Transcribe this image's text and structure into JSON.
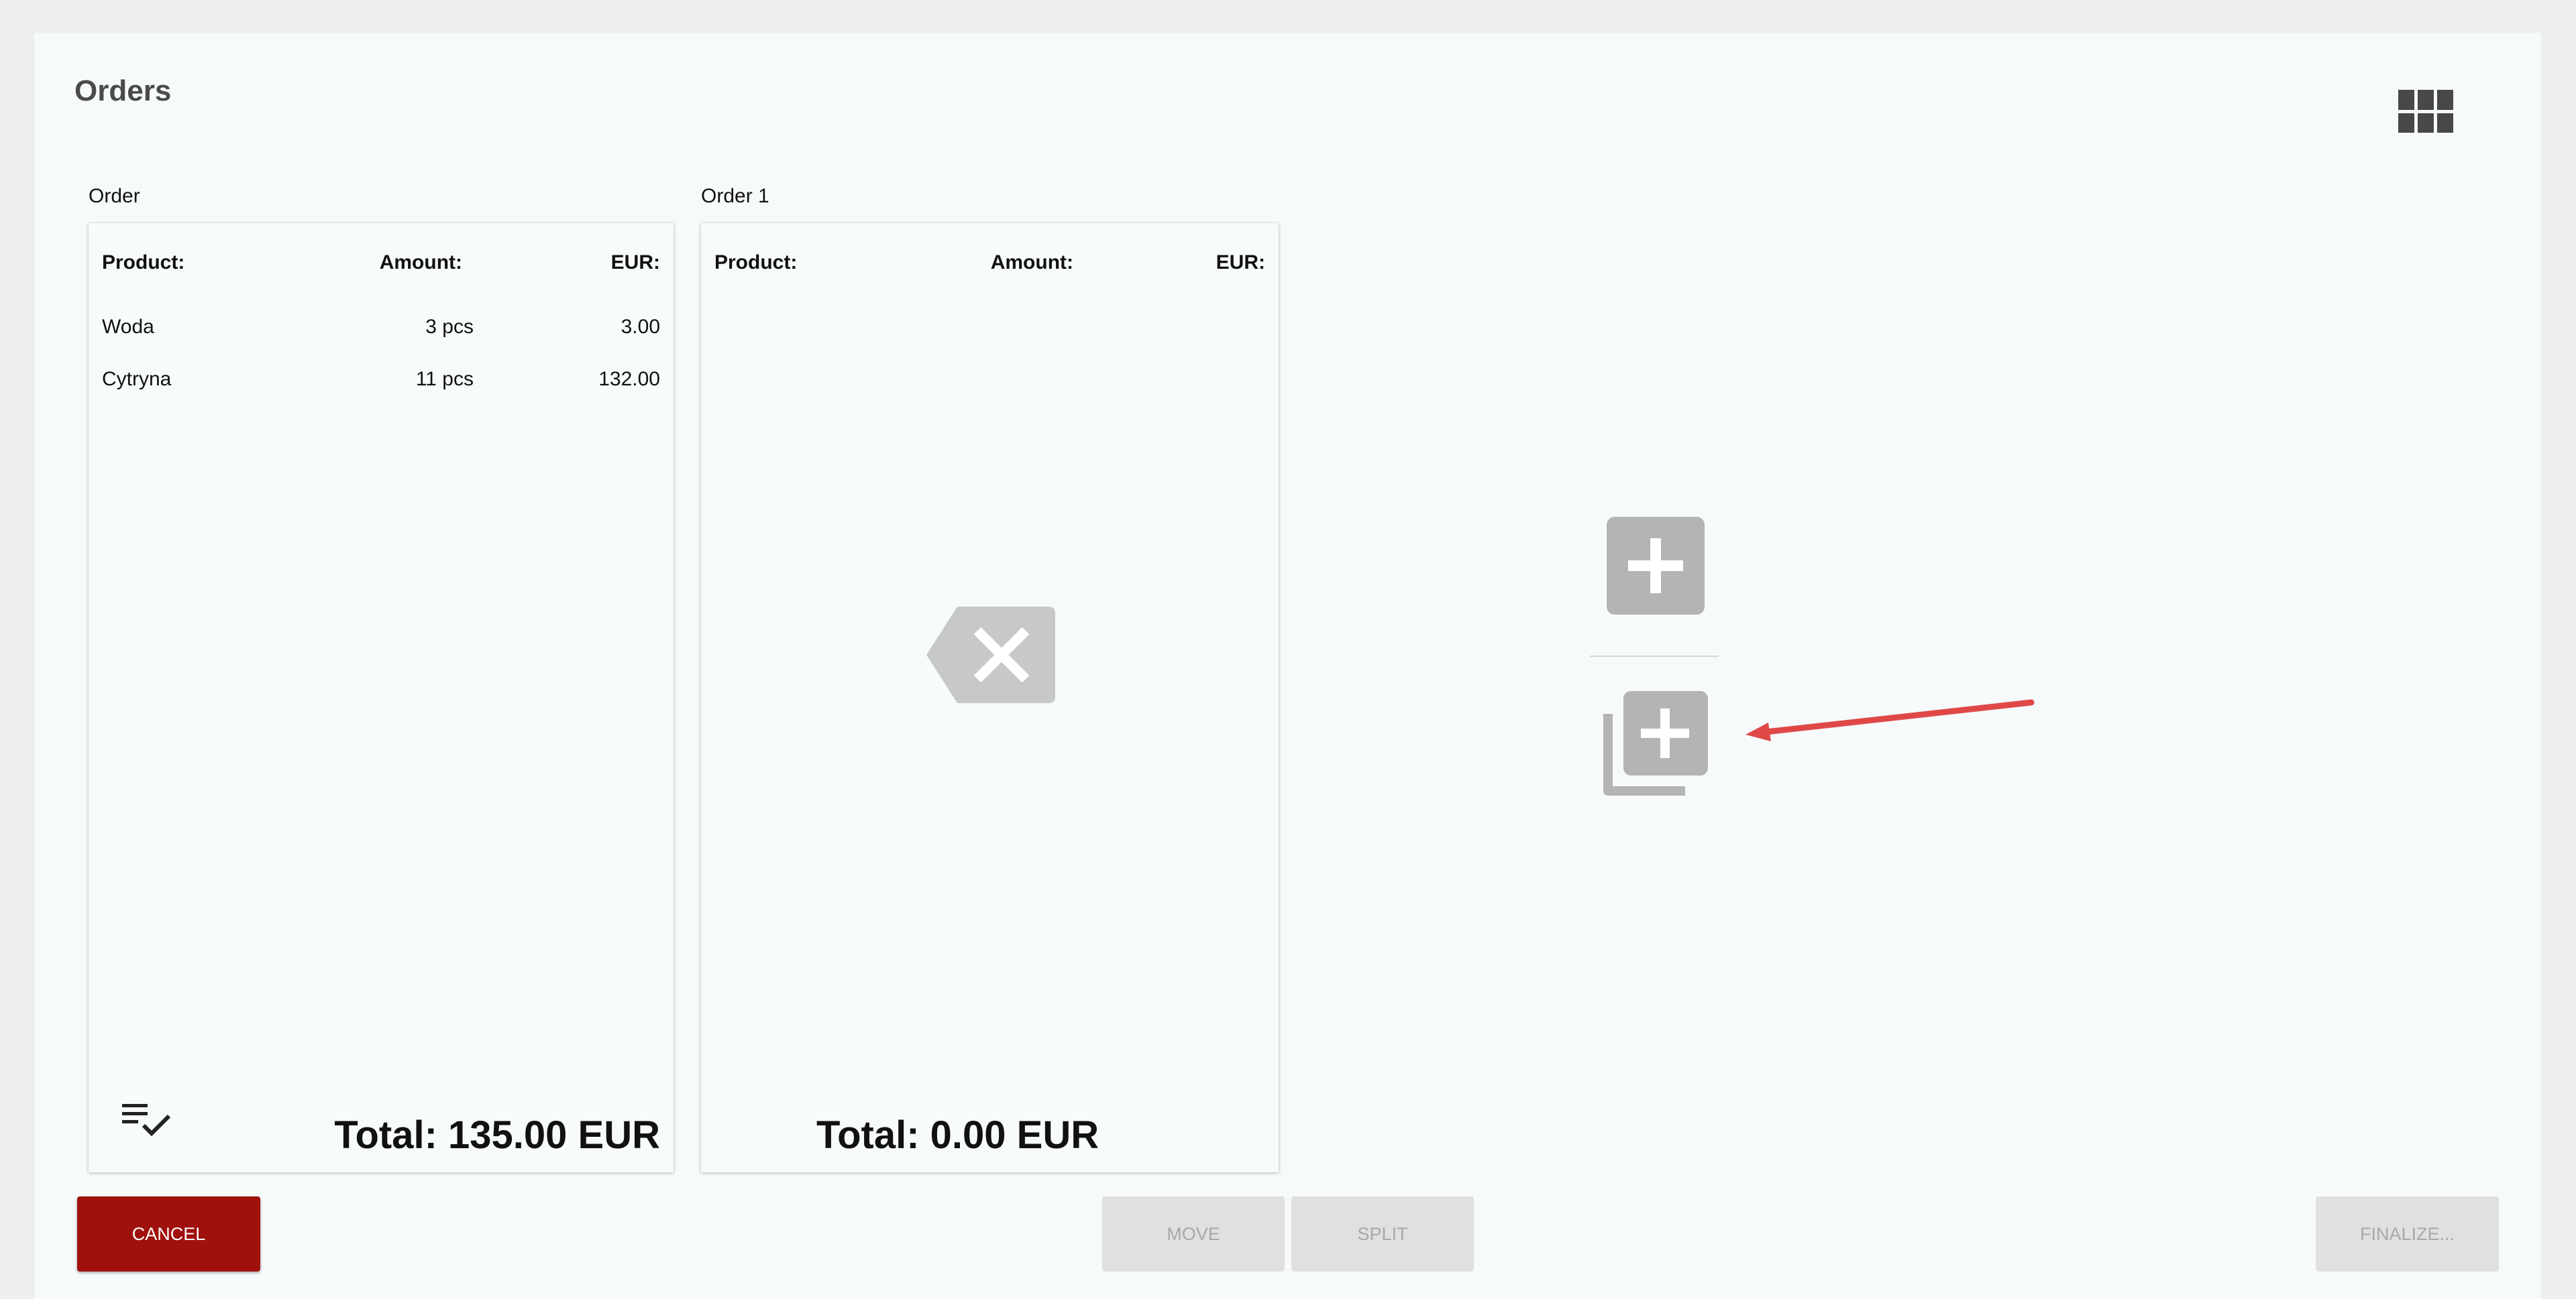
{
  "page": {
    "title": "Orders"
  },
  "header": {
    "grid_icon": "grid-view-icon"
  },
  "orders": [
    {
      "label": "Order",
      "columns": {
        "product": "Product:",
        "amount": "Amount:",
        "eur": "EUR:"
      },
      "items": [
        {
          "product": "Woda",
          "amount": "3 pcs",
          "eur": "3.00"
        },
        {
          "product": "Cytryna",
          "amount": "11 pcs",
          "eur": "132.00"
        }
      ],
      "total": "Total: 135.00 EUR",
      "footer_icon": "checklist-icon"
    },
    {
      "label": "Order 1",
      "columns": {
        "product": "Product:",
        "amount": "Amount:",
        "eur": "EUR:"
      },
      "items": [],
      "total": "Total: 0.00 EUR",
      "placeholder_icon": "clear-backspace-icon"
    }
  ],
  "actions": {
    "add_icon": "add-order-icon",
    "add_copy_icon": "add-copy-order-icon",
    "annotation": "red-arrow"
  },
  "buttons": {
    "cancel": "CANCEL",
    "move": "MOVE",
    "split": "SPLIT",
    "finalize": "FINALIZE..."
  },
  "colors": {
    "cancel_bg": "#a0100c",
    "icon_gray": "#b4b4b4",
    "arrow_red": "#e04848",
    "disabled_bg": "#e0e0e0",
    "disabled_text": "#a8a8a8"
  }
}
